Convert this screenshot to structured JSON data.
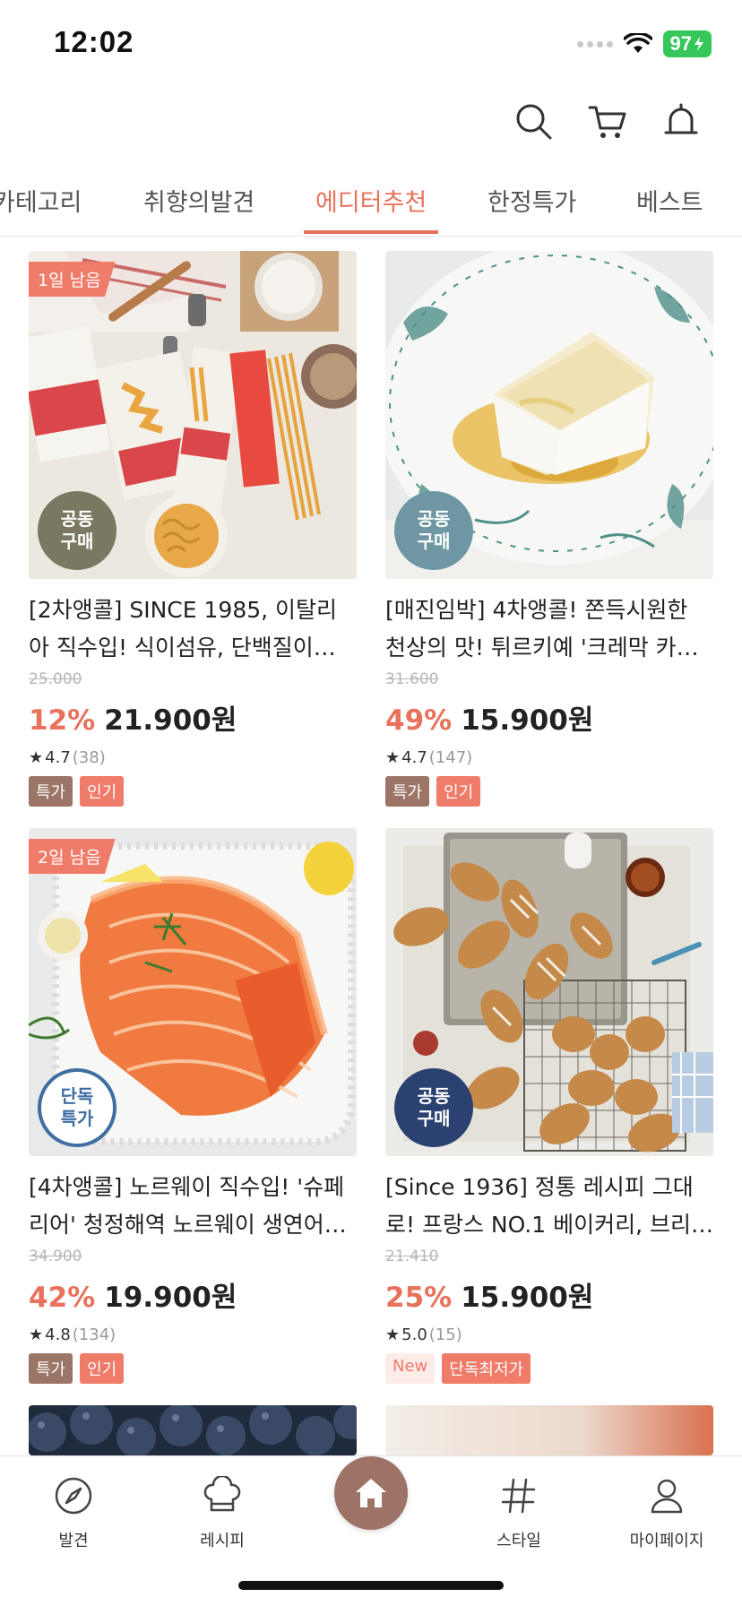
{
  "status_bar": {
    "time": "12:02",
    "battery": "97"
  },
  "header": {
    "icons": [
      "search-icon",
      "cart-icon",
      "bell-icon"
    ]
  },
  "tabs": [
    {
      "label": "카테고리"
    },
    {
      "label": "취향의발견"
    },
    {
      "label": "에디터추천",
      "active": true
    },
    {
      "label": "한정특가"
    },
    {
      "label": "베스트"
    }
  ],
  "products": [
    {
      "dday": "1일 남음",
      "badge": "공동\n구매",
      "badge_color": "#7a7860",
      "title": "[2차앵콜] SINCE 1985, 이탈리아 직수입! 식이섬유, 단백질이…",
      "orig_price": "25.000",
      "discount": "12%",
      "price": "21.900원",
      "rating": "4.7",
      "review_count": "(38)",
      "tags": [
        "특가",
        "인기"
      ]
    },
    {
      "dday": "",
      "badge": "공동\n구매",
      "badge_color": "#6e97a3",
      "title": "[매진임박] 4차앵콜! 쫀득시원한 천상의 맛! 튀르키예 '크레막 카…",
      "orig_price": "31.600",
      "discount": "49%",
      "price": "15.900원",
      "rating": "4.7",
      "review_count": "(147)",
      "tags": [
        "특가",
        "인기"
      ]
    },
    {
      "dday": "2일 남음",
      "badge": "단독\n특가",
      "badge_color": "#3f6ea3",
      "title": "[4차앵콜] 노르웨이 직수입!  '슈페리어' 청정해역 노르웨이 생연어…",
      "orig_price": "34.900",
      "discount": "42%",
      "price": "19.900원",
      "rating": "4.8",
      "review_count": "(134)",
      "tags": [
        "특가",
        "인기"
      ]
    },
    {
      "dday": "",
      "badge": "공동\n구매",
      "badge_color": "#2b4170",
      "title": "[Since 1936] 정통 레시피 그대로! 프랑스 NO.1 베이커리, 브리…",
      "orig_price": "21.410",
      "discount": "25%",
      "price": "15.900원",
      "rating": "5.0",
      "review_count": "(15)",
      "tags": [
        "New",
        "단독최저가"
      ]
    }
  ],
  "bottom_nav": [
    {
      "label": "발견",
      "icon": "compass-icon"
    },
    {
      "label": "레시피",
      "icon": "chef-hat-icon"
    },
    {
      "label": "",
      "icon": "home-icon"
    },
    {
      "label": "스타일",
      "icon": "hashtag-icon"
    },
    {
      "label": "마이페이지",
      "icon": "person-icon"
    }
  ],
  "colors": {
    "accent": "#e8725c",
    "brand_brown": "#9d7367",
    "tag_brown": "#9b7566",
    "tag_coral": "#ef7b69"
  }
}
